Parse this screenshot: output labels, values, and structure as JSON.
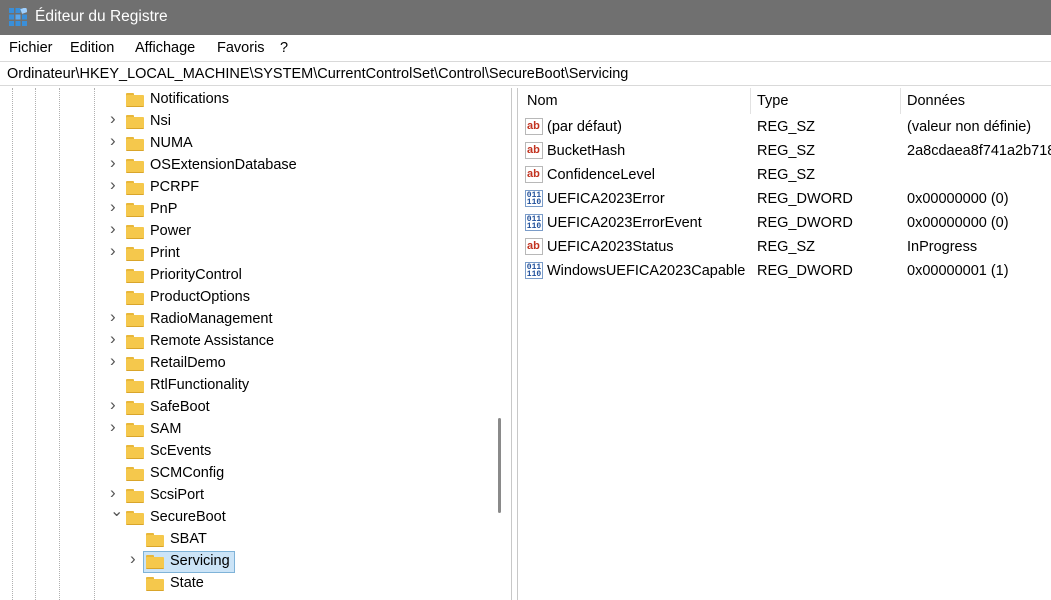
{
  "window": {
    "title": "Éditeur du Registre"
  },
  "colors": {
    "titlebar": "#707070",
    "folder": "#f5c84c",
    "selection": "#cce4f7",
    "string_icon": "#c2321f",
    "binary_icon": "#1f4f9a"
  },
  "menu": {
    "items": [
      "Fichier",
      "Edition",
      "Affichage",
      "Favoris",
      "?"
    ]
  },
  "address": {
    "path": "Ordinateur\\HKEY_LOCAL_MACHINE\\SYSTEM\\CurrentControlSet\\Control\\SecureBoot\\Servicing"
  },
  "tree": {
    "nodes": [
      {
        "label": "Notifications",
        "expander": "none",
        "icon": "folder-icon"
      },
      {
        "label": "Nsi",
        "expander": "collapsed",
        "icon": "folder-icon"
      },
      {
        "label": "NUMA",
        "expander": "collapsed",
        "icon": "folder-icon"
      },
      {
        "label": "OSExtensionDatabase",
        "expander": "collapsed",
        "icon": "folder-icon"
      },
      {
        "label": "PCRPF",
        "expander": "collapsed",
        "icon": "folder-icon"
      },
      {
        "label": "PnP",
        "expander": "collapsed",
        "icon": "folder-icon"
      },
      {
        "label": "Power",
        "expander": "collapsed",
        "icon": "folder-icon"
      },
      {
        "label": "Print",
        "expander": "collapsed",
        "icon": "folder-icon"
      },
      {
        "label": "PriorityControl",
        "expander": "none",
        "icon": "folder-icon"
      },
      {
        "label": "ProductOptions",
        "expander": "none",
        "icon": "folder-icon"
      },
      {
        "label": "RadioManagement",
        "expander": "collapsed",
        "icon": "folder-icon"
      },
      {
        "label": "Remote Assistance",
        "expander": "collapsed",
        "icon": "folder-icon"
      },
      {
        "label": "RetailDemo",
        "expander": "collapsed",
        "icon": "folder-icon"
      },
      {
        "label": "RtlFunctionality",
        "expander": "none",
        "icon": "folder-icon"
      },
      {
        "label": "SafeBoot",
        "expander": "collapsed",
        "icon": "folder-icon"
      },
      {
        "label": "SAM",
        "expander": "collapsed",
        "icon": "folder-icon"
      },
      {
        "label": "ScEvents",
        "expander": "none",
        "icon": "folder-icon"
      },
      {
        "label": "SCMConfig",
        "expander": "none",
        "icon": "folder-icon"
      },
      {
        "label": "ScsiPort",
        "expander": "collapsed",
        "icon": "folder-icon"
      },
      {
        "label": "SecureBoot",
        "expander": "expanded",
        "icon": "folder-icon"
      },
      {
        "label": "SBAT",
        "expander": "none",
        "icon": "folder-icon"
      },
      {
        "label": "Servicing",
        "expander": "collapsed",
        "icon": "folder-icon",
        "selected": true
      },
      {
        "label": "State",
        "expander": "none",
        "icon": "folder-icon"
      }
    ]
  },
  "list": {
    "columns": [
      "Nom",
      "Type",
      "Données"
    ],
    "rows": [
      {
        "name": "(par défaut)",
        "type": "REG_SZ",
        "data": "(valeur non définie)",
        "icon": "string-value-icon"
      },
      {
        "name": "BucketHash",
        "type": "REG_SZ",
        "data": "2a8cdaea8f741a2b718",
        "icon": "string-value-icon"
      },
      {
        "name": "ConfidenceLevel",
        "type": "REG_SZ",
        "data": "",
        "icon": "string-value-icon"
      },
      {
        "name": "UEFICA2023Error",
        "type": "REG_DWORD",
        "data": "0x00000000 (0)",
        "icon": "binary-value-icon"
      },
      {
        "name": "UEFICA2023ErrorEvent",
        "type": "REG_DWORD",
        "data": "0x00000000 (0)",
        "icon": "binary-value-icon"
      },
      {
        "name": "UEFICA2023Status",
        "type": "REG_SZ",
        "data": "InProgress",
        "icon": "string-value-icon"
      },
      {
        "name": "WindowsUEFICA2023Capable",
        "type": "REG_DWORD",
        "data": "0x00000001 (1)",
        "icon": "binary-value-icon"
      }
    ]
  }
}
